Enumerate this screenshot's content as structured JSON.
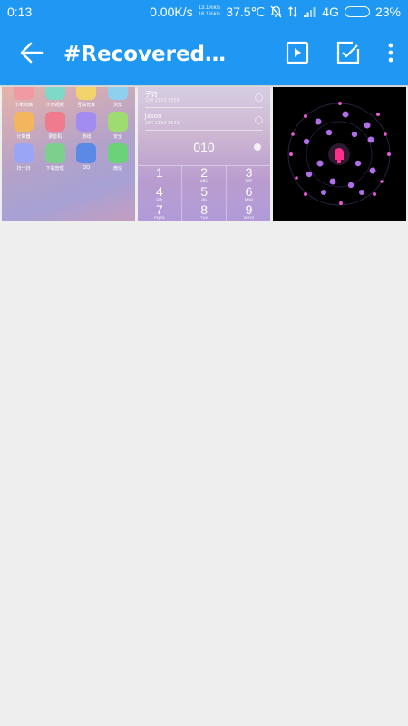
{
  "status_bar": {
    "time": "0:13",
    "net_speed": "0.00K/s",
    "net_speed_up": "13.1%k/s",
    "net_speed_down": "16.1%k/s",
    "temperature": "37.5℃",
    "network": "4G",
    "battery": "23%"
  },
  "app_bar": {
    "title": "#Recovered p...",
    "back_icon": "arrow-left-icon",
    "actions": [
      "play-slideshow-icon",
      "select-all-checkbox-icon",
      "more-vert-icon"
    ]
  },
  "thumbnails": {
    "tile1": {
      "rows": [
        [
          "小米商城",
          "小米视频",
          "互联管家",
          "浏览"
        ],
        [
          "计算器",
          "录音机",
          "游戏",
          "安全"
        ],
        [
          "扫一扫",
          "下载管理",
          "QQ",
          "微信"
        ]
      ],
      "colors": [
        "#f19aa3",
        "#7ed9c8",
        "#f3d36b",
        "#8fd0ef",
        "#f3b65e",
        "#f07b8e",
        "#a28cf0",
        "#9edc72",
        "#9aa6f5",
        "#7ccf8c",
        "#5b89e6",
        "#6bd27a"
      ]
    },
    "tile2": {
      "contacts": [
        {
          "name": "子钧",
          "sub": "154 2133 5558"
        },
        {
          "name": "Jason",
          "sub": "154 2133 5533"
        }
      ],
      "dial_number": "010",
      "keypad": [
        [
          {
            "d": "1",
            "l": ""
          },
          {
            "d": "4",
            "l": "GHI"
          },
          {
            "d": "7",
            "l": "PQRS"
          }
        ],
        [
          {
            "d": "2",
            "l": "ABC"
          },
          {
            "d": "5",
            "l": "JKL"
          },
          {
            "d": "8",
            "l": "TUV"
          }
        ],
        [
          {
            "d": "3",
            "l": "DEF"
          },
          {
            "d": "6",
            "l": "MNO"
          },
          {
            "d": "9",
            "l": "WXYZ"
          }
        ]
      ]
    }
  },
  "colors": {
    "primary": "#1f98f3",
    "background": "#eeeeee",
    "accent_pink": "#ff2e8a",
    "accent_purple": "#b06ee8"
  }
}
